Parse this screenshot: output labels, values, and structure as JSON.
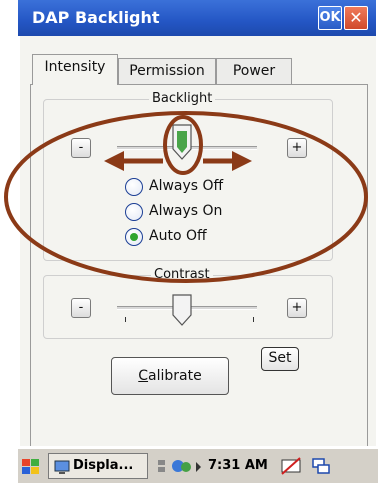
{
  "window": {
    "title": "DAP Backlight",
    "ok_label": "OK",
    "close_label": "✕"
  },
  "tabs": [
    {
      "label": "Intensity",
      "active": true
    },
    {
      "label": "Permission",
      "active": false
    },
    {
      "label": "Power",
      "active": false
    }
  ],
  "backlight": {
    "group_label": "Backlight",
    "minus_label": "-",
    "plus_label": "+",
    "options": [
      {
        "label": "Always Off",
        "selected": false
      },
      {
        "label": "Always On",
        "selected": false
      },
      {
        "label": "Auto Off",
        "selected": true
      }
    ]
  },
  "contrast": {
    "group_label": "Contrast",
    "minus_label": "-",
    "plus_label": "+",
    "set_label": "Set"
  },
  "calibrate_label": "Calibrate",
  "taskbar": {
    "task_label": "Displa...",
    "clock": "7:31 AM"
  },
  "colors": {
    "titlebar": "#2456c4",
    "annotation": "#8b3a17",
    "selected_radio": "#2fa52f"
  }
}
